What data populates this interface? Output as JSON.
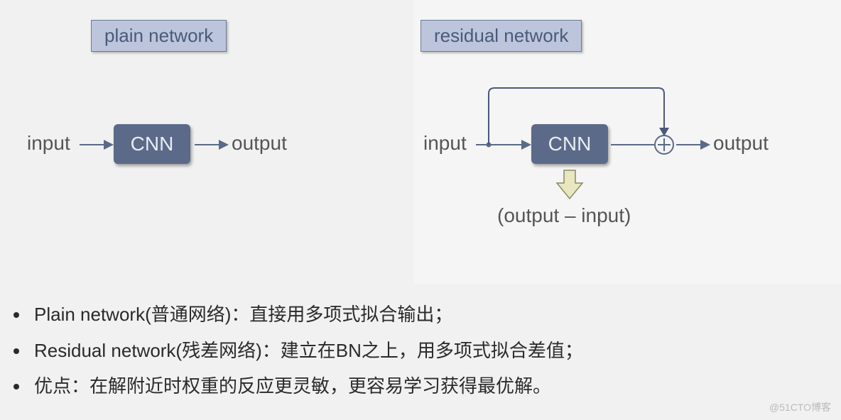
{
  "left": {
    "title": "plain network",
    "input": "input",
    "box": "CNN",
    "output": "output"
  },
  "right": {
    "title": "residual network",
    "input": "input",
    "box": "CNN",
    "output": "output",
    "below": "(output – input)"
  },
  "bullets": [
    "Plain network(普通网络)：直接用多项式拟合输出；",
    "Residual network(残差网络)：建立在BN之上，用多项式拟合差值；",
    "优点：在解附近时权重的反应更灵敏，更容易学习获得最优解。"
  ],
  "watermark": "@51CTO博客",
  "colors": {
    "box_bg": "#5b6a88",
    "title_bg": "#bcc5db",
    "arrow": "#5b6a88",
    "skip_stroke": "#4a5a7a",
    "down_arrow_fill": "#e8e7bf",
    "down_arrow_stroke": "#8a8a66"
  }
}
